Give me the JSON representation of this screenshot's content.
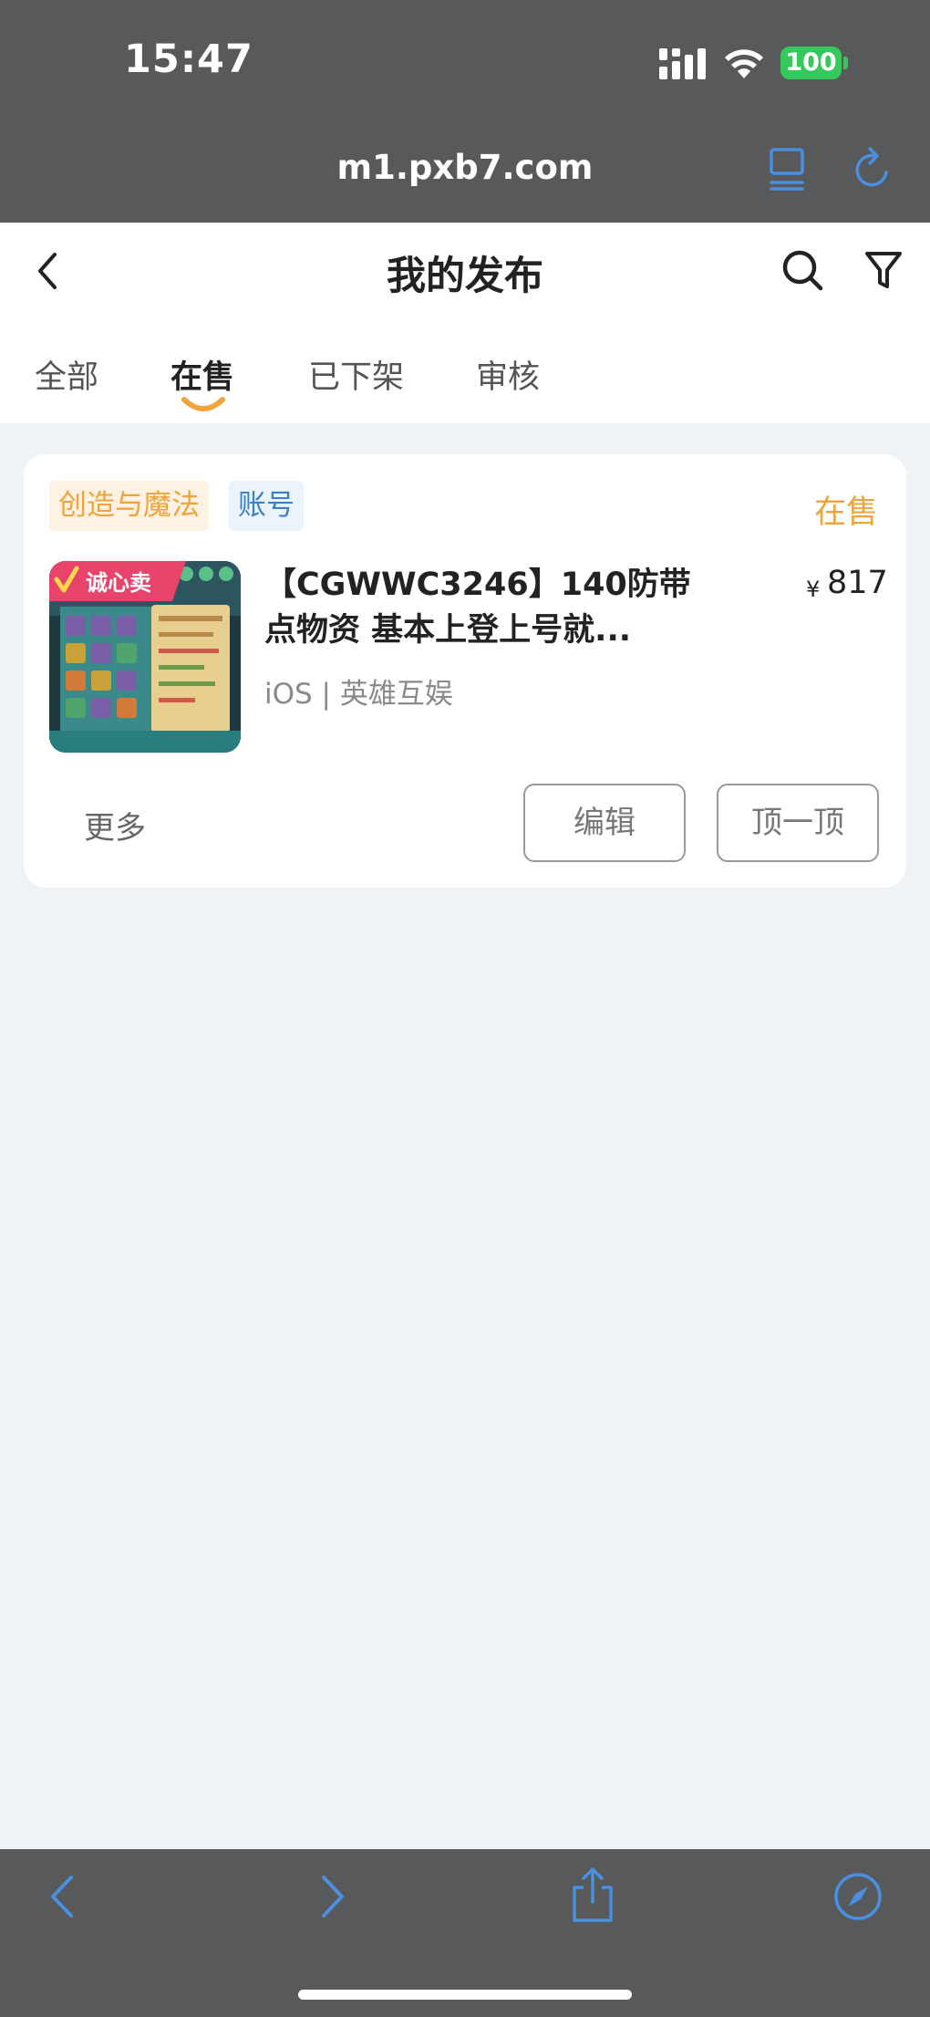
{
  "status_bar": {
    "time": "15:47",
    "battery": "100"
  },
  "browser": {
    "url": "m1.pxb7.com"
  },
  "header": {
    "title": "我的发布"
  },
  "tabs": [
    {
      "label": "全部"
    },
    {
      "label": "在售"
    },
    {
      "label": "已下架"
    },
    {
      "label": "审核"
    }
  ],
  "active_tab": "在售",
  "listing": {
    "game_tag": "创造与魔法",
    "type_tag": "账号",
    "status": "在售",
    "thumb_badge": "诚心卖",
    "title": "【CGWWC3246】140防带点物资 基本上登上号就...",
    "price_symbol": "¥",
    "price": "817",
    "meta": "iOS | 英雄互娱",
    "more_label": "更多",
    "edit_label": "编辑",
    "bump_label": "顶一顶"
  },
  "colors": {
    "accent": "#f0a43a",
    "link_blue": "#3b7fc4",
    "chrome_bg": "#58595b",
    "page_bg": "#f0f3f6",
    "safari_blue": "#4a8fe0"
  },
  "icons": [
    "back-icon",
    "search-icon",
    "filter-icon",
    "signal-icon",
    "wifi-icon",
    "reader-icon",
    "reload-icon",
    "share-icon",
    "compass-icon"
  ]
}
